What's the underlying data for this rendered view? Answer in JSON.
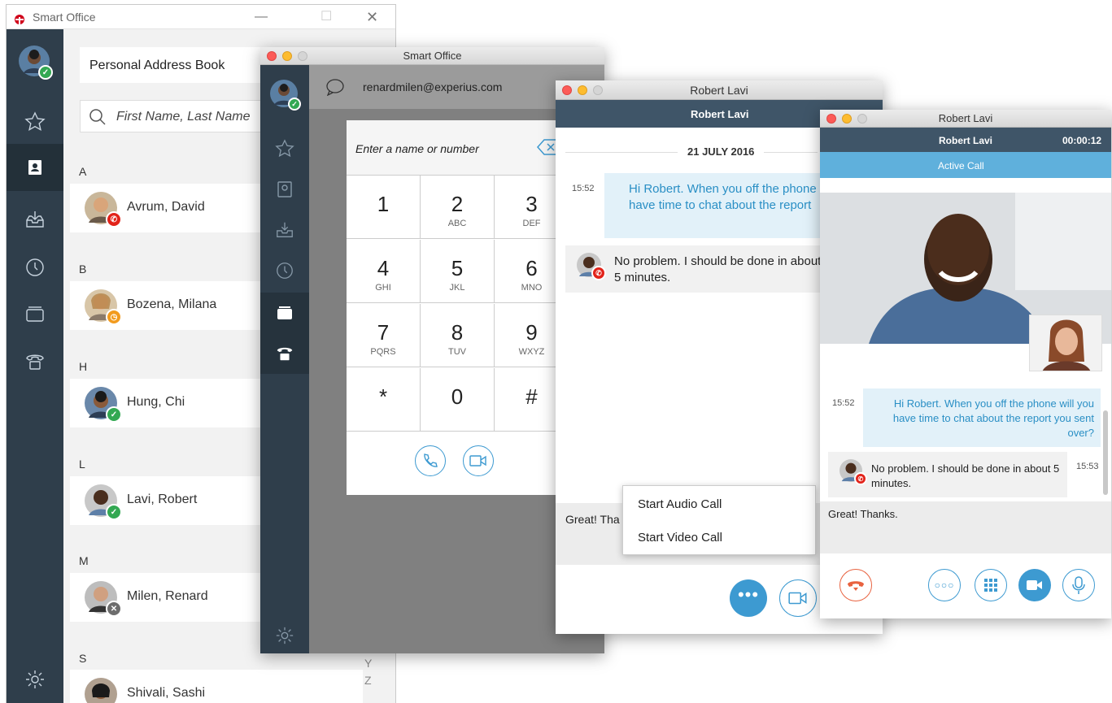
{
  "w1": {
    "title": "Smart Office",
    "address_book_label": "Personal Address Book",
    "search_placeholder": "First Name, Last Name",
    "alpha_y": "Y",
    "alpha_z": "Z",
    "sections": [
      {
        "letter": "A",
        "name": "Avrum, David",
        "status": "busy"
      },
      {
        "letter": "B",
        "name": "Bozena, Milana",
        "status": "away"
      },
      {
        "letter": "H",
        "name": "Hung, Chi",
        "status": "available"
      },
      {
        "letter": "L",
        "name": "Lavi, Robert",
        "status": "available"
      },
      {
        "letter": "M",
        "name": "Milen, Renard",
        "status": "offline"
      },
      {
        "letter": "S",
        "name": "Shivali, Sashi",
        "status": "available"
      }
    ]
  },
  "w2": {
    "title": "Smart Office",
    "email": "renardmilen@experius.com",
    "dial_placeholder": "Enter a name or number",
    "keys": [
      {
        "num": "1",
        "letters": ""
      },
      {
        "num": "2",
        "letters": "ABC"
      },
      {
        "num": "3",
        "letters": "DEF"
      },
      {
        "num": "4",
        "letters": "GHI"
      },
      {
        "num": "5",
        "letters": "JKL"
      },
      {
        "num": "6",
        "letters": "MNO"
      },
      {
        "num": "7",
        "letters": "PQRS"
      },
      {
        "num": "8",
        "letters": "TUV"
      },
      {
        "num": "9",
        "letters": "WXYZ"
      },
      {
        "num": "*",
        "letters": ""
      },
      {
        "num": "0",
        "letters": ""
      },
      {
        "num": "#",
        "letters": ""
      }
    ]
  },
  "w3": {
    "title": "Robert Lavi",
    "header": "Robert Lavi",
    "date": "21 JULY 2016",
    "msg1_time": "15:52",
    "msg1": "Hi Robert. When you off the phone have time to chat about the report",
    "msg2": "No problem. I should be done in about 5 minutes.",
    "compose": "Great! Tha",
    "menu_audio": "Start Audio Call",
    "menu_video": "Start Video Call"
  },
  "w4": {
    "title": "Robert Lavi",
    "header": "Robert Lavi",
    "timer": "00:00:12",
    "status": "Active Call",
    "msg1_time": "15:52",
    "msg1": "Hi Robert. When you off the phone will you have time to chat about the report you sent over?",
    "msg2": "No problem. I should be done in about 5 minutes.",
    "msg2_time": "15:53",
    "compose": "Great! Thanks."
  },
  "colors": {
    "sidebar": "#2f3e4b",
    "accent": "#3d9ad1",
    "header": "#3f5568",
    "active_call": "#5fb0dc",
    "hangup": "#e8623f"
  }
}
